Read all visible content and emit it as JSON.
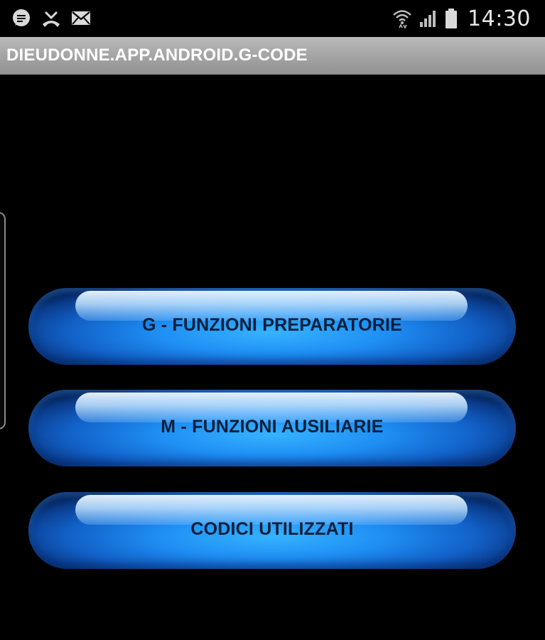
{
  "status_bar": {
    "left_icons": [
      "message-bubble-icon",
      "missed-call-icon",
      "mail-icon"
    ],
    "right_icons": [
      "wifi-icon",
      "signal-icon",
      "battery-icon"
    ],
    "time": "14:30"
  },
  "title_bar": {
    "title": "DIEUDONNE.APP.ANDROID.G-CODE"
  },
  "buttons": [
    {
      "label": "G - FUNZIONI PREPARATORIE"
    },
    {
      "label": "M - FUNZIONI AUSILIARIE"
    },
    {
      "label": "CODICI UTILIZZATI"
    }
  ],
  "colors": {
    "background": "#000000",
    "title_bar": "#a3a3a3",
    "title_text": "#ffffff",
    "button_blue": "#1f8ff4",
    "button_text": "#0b1f3a"
  }
}
